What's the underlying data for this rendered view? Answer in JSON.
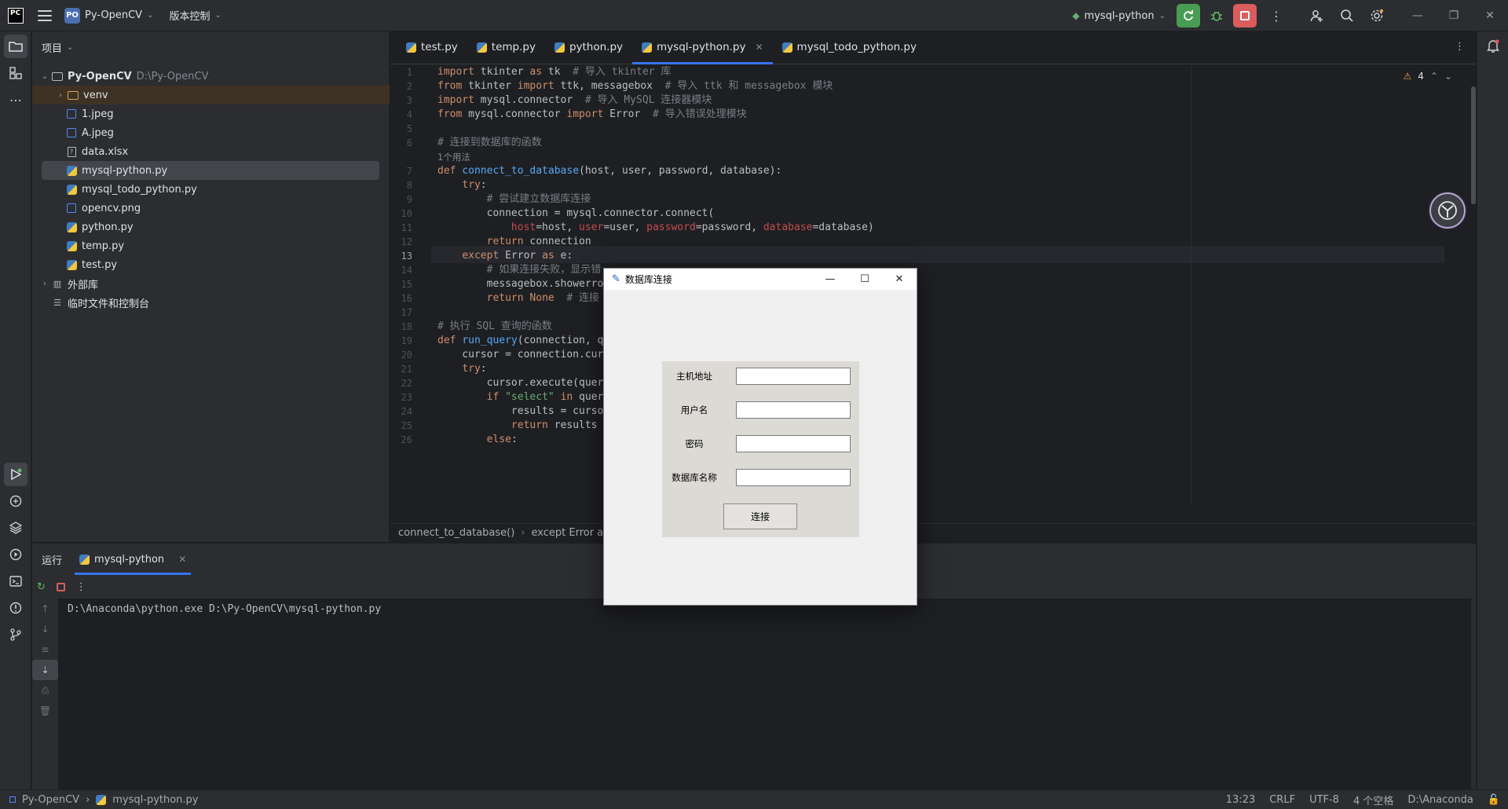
{
  "titlebar": {
    "logo": "PC",
    "project_badge": "PO",
    "project_name": "Py-OpenCV",
    "vcs_label": "版本控制",
    "run_config": "mysql-python"
  },
  "project_panel": {
    "header": "项目",
    "root_name": "Py-OpenCV",
    "root_path": "D:\\Py-OpenCV",
    "items": [
      {
        "label": "venv",
        "type": "folder"
      },
      {
        "label": "1.jpeg",
        "type": "image"
      },
      {
        "label": "A.jpeg",
        "type": "image"
      },
      {
        "label": "data.xlsx",
        "type": "sheet"
      },
      {
        "label": "mysql-python.py",
        "type": "python"
      },
      {
        "label": "mysql_todo_python.py",
        "type": "python"
      },
      {
        "label": "opencv.png",
        "type": "image"
      },
      {
        "label": "python.py",
        "type": "python"
      },
      {
        "label": "temp.py",
        "type": "python"
      },
      {
        "label": "test.py",
        "type": "python"
      }
    ],
    "external_libs": "外部库",
    "scratches": "临时文件和控制台"
  },
  "editor": {
    "tabs": [
      "test.py",
      "temp.py",
      "python.py",
      "mysql-python.py",
      "mysql_todo_python.py"
    ],
    "active_tab": "mysql-python.py",
    "warning_count": "4",
    "usage_hint": "1个用法",
    "line_numbers": [
      "1",
      "2",
      "3",
      "4",
      "5",
      "6",
      "7",
      "8",
      "9",
      "10",
      "11",
      "12",
      "13",
      "14",
      "15",
      "16",
      "17",
      "18",
      "19",
      "20",
      "21",
      "22",
      "23",
      "24",
      "25",
      "26"
    ],
    "current_line": "13",
    "breadcrumb": [
      "connect_to_database()",
      "except Error as e"
    ]
  },
  "run_panel": {
    "title": "运行",
    "tab": "mysql-python",
    "console_output": "D:\\Anaconda\\python.exe D:\\Py-OpenCV\\mysql-python.py"
  },
  "statusbar": {
    "project": "Py-OpenCV",
    "file": "mysql-python.py",
    "position": "13:23",
    "line_sep": "CRLF",
    "encoding": "UTF-8",
    "indent": "4 个空格",
    "interpreter": "D:\\Anaconda"
  },
  "dialog": {
    "title": "数据库连接",
    "fields": [
      {
        "label": "主机地址",
        "value": ""
      },
      {
        "label": "用户名",
        "value": ""
      },
      {
        "label": "密码",
        "value": ""
      },
      {
        "label": "数据库名称",
        "value": ""
      }
    ],
    "button": "连接"
  },
  "colors": {
    "accent": "#3574f0",
    "run_green": "#499c54",
    "stop_red": "#db5c5c",
    "keyword": "#cf8e6d",
    "function": "#56a8f5",
    "comment": "#7a7e85"
  }
}
